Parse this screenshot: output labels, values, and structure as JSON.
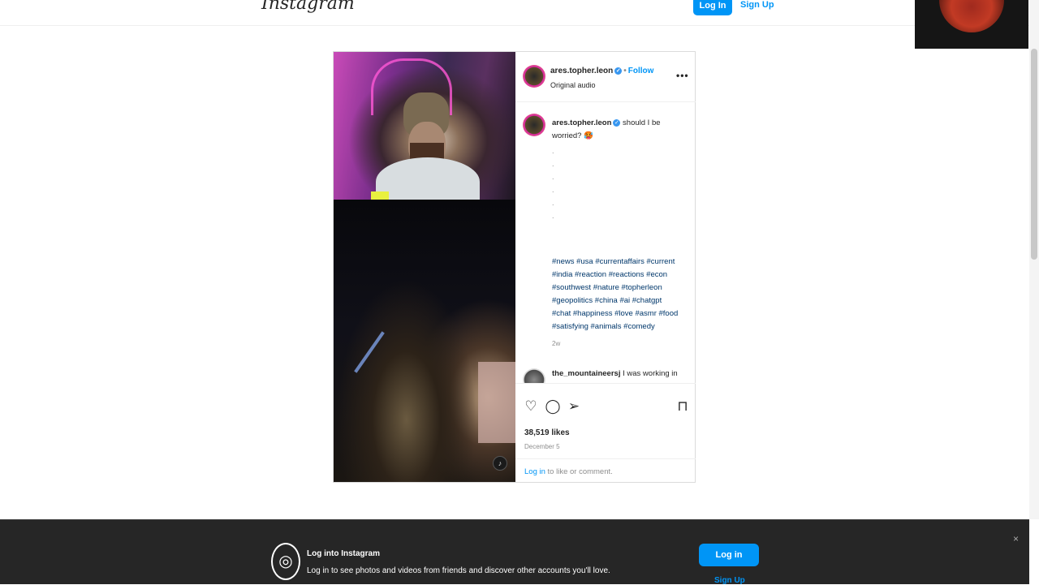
{
  "topbar": {
    "logo": "Instagram",
    "login": "Log In",
    "signup": "Sign Up"
  },
  "post": {
    "header": {
      "username": "ares.topher.leon",
      "follow": "Follow",
      "audio": "Original audio",
      "more": "•••"
    },
    "caption": {
      "username": "ares.topher.leon",
      "text": "should I be worried? 🥵",
      "dots": ".\n.\n.\n.\n.\n.",
      "hashtags": "#news #usa #currentaffairs #current #india #reaction #reactions #econ #southwest #nature #topherleon #geopolitics #china #ai #chatgpt #chat #happiness #love #asmr #food #satisfying #animals #comedy",
      "age": "2w"
    },
    "comment": {
      "username": "the_mountaineersj",
      "text": "I was working in a neighborhood nearby a little while beforehand. I did however at around 3pm hear several loud booms to the south of me 🤔💁"
    },
    "actions": {
      "like_icon": "heart-icon",
      "comment_icon": "comment-icon",
      "share_icon": "share-icon",
      "save_icon": "bookmark-icon"
    },
    "likes": "38,519 likes",
    "date": "December 5",
    "login_link": "Log in",
    "login_rest": " to like or comment."
  },
  "banner": {
    "title": "Log into Instagram",
    "subtitle": "Log in to see photos and videos from friends and discover other accounts you'll love.",
    "login": "Log in",
    "signup": "Sign Up",
    "close": "×"
  }
}
